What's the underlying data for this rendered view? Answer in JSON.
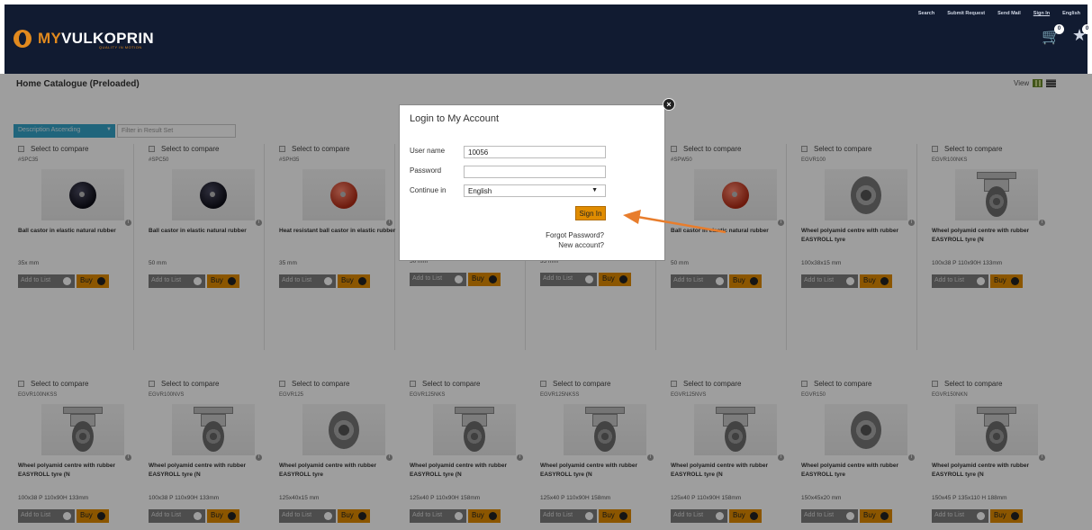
{
  "header": {
    "logo_my": "MY",
    "logo_brand": "VULKOPRIN",
    "logo_tagline": "QUALITY IN MOTION",
    "nav": [
      {
        "label": "Search"
      },
      {
        "label": "Submit Request"
      },
      {
        "label": "Send Mail"
      },
      {
        "label": "Sign In"
      },
      {
        "label": "English"
      }
    ],
    "cart_count": "0",
    "wishlist_count": "0"
  },
  "page": {
    "title": "Home Catalogue (Preloaded)",
    "view_label": "View",
    "sort_value": "Description Ascending",
    "filter_placeholder": "Filter in Result Set"
  },
  "products": [
    {
      "compare": "Select to compare",
      "code": "#SPC35",
      "desc": "Ball castor in elastic natural rubber",
      "size": "35x mm",
      "add": "Add to List",
      "buy": "Buy"
    },
    {
      "compare": "Select to compare",
      "code": "#SPC50",
      "desc": "Ball castor in elastic natural rubber",
      "size": "50 mm",
      "add": "Add to List",
      "buy": "Buy"
    },
    {
      "compare": "Select to compare",
      "code": "#SPH35",
      "desc": "Heat resistant ball castor in elastic rubber",
      "size": "35 mm",
      "add": "Add to List",
      "buy": "Buy"
    },
    {
      "compare": "",
      "code": "",
      "desc": "",
      "size": "50 mm",
      "add": "Add to List",
      "buy": "Buy"
    },
    {
      "compare": "",
      "code": "",
      "desc": "",
      "size": "35 mm",
      "add": "Add to List",
      "buy": "Buy"
    },
    {
      "compare": "Select to compare",
      "code": "#SPW50",
      "desc": "Ball castor in elastic natural rubber",
      "size": "50 mm",
      "add": "Add to List",
      "buy": "Buy"
    },
    {
      "compare": "Select to compare",
      "code": "EGVR100",
      "desc": "Wheel polyamid centre with rubber EASYROLL tyre",
      "size": "100x38x15 mm",
      "add": "Add to List",
      "buy": "Buy"
    },
    {
      "compare": "Select to compare",
      "code": "EGVR100NKS",
      "desc": "Wheel polyamid centre with rubber EASYROLL tyre (N",
      "size": "100x38 P 110x90H 133mm",
      "add": "Add to List",
      "buy": "Buy"
    },
    {
      "compare": "Select to compare",
      "code": "EGVR100NKSS",
      "desc": "Wheel polyamid centre with rubber EASYROLL tyre (N",
      "size": "100x38 P 110x90H 133mm",
      "add": "Add to List",
      "buy": "Buy"
    },
    {
      "compare": "Select to compare",
      "code": "EGVR100NVS",
      "desc": "Wheel polyamid centre with rubber EASYROLL tyre (N",
      "size": "100x38 P 110x90H 133mm",
      "add": "Add to List",
      "buy": "Buy"
    },
    {
      "compare": "Select to compare",
      "code": "EGVR125",
      "desc": "Wheel polyamid centre with rubber EASYROLL tyre",
      "size": "125x40x15 mm",
      "add": "Add to List",
      "buy": "Buy"
    },
    {
      "compare": "Select to compare",
      "code": "EGVR125NKS",
      "desc": "Wheel polyamid centre with rubber EASYROLL tyre (N",
      "size": "125x40 P 110x90H 158mm",
      "add": "Add to List",
      "buy": "Buy"
    },
    {
      "compare": "Select to compare",
      "code": "EGVR125NKSS",
      "desc": "Wheel polyamid centre with rubber EASYROLL tyre (N",
      "size": "125x40 P 110x90H 158mm",
      "add": "Add to List",
      "buy": "Buy"
    },
    {
      "compare": "Select to compare",
      "code": "EGVR125NVS",
      "desc": "Wheel polyamid centre with rubber EASYROLL tyre (N",
      "size": "125x40 P 110x90H 158mm",
      "add": "Add to List",
      "buy": "Buy"
    },
    {
      "compare": "Select to compare",
      "code": "EGVR150",
      "desc": "Wheel polyamid centre with rubber EASYROLL tyre",
      "size": "150x45x20 mm",
      "add": "Add to List",
      "buy": "Buy"
    },
    {
      "compare": "Select to compare",
      "code": "EGVR150NKN",
      "desc": "Wheel polyamid centre with rubber EASYROLL tyre (N",
      "size": "150x45 P 135x110 H 188mm",
      "add": "Add to List",
      "buy": "Buy"
    }
  ],
  "modal": {
    "title": "Login to My Account",
    "username_label": "User name",
    "username_value": "10056",
    "password_label": "Password",
    "password_value": "",
    "continue_label": "Continue in",
    "language_value": "English",
    "signin_label": "Sign In",
    "forgot_label": "Forgot Password?",
    "new_account_label": "New account?",
    "close_glyph": "×"
  },
  "colors": {
    "header_bg": "#111b31",
    "brand_orange": "#e28a1e",
    "button_orange": "#e08c00",
    "arrow": "#e87d2c"
  }
}
